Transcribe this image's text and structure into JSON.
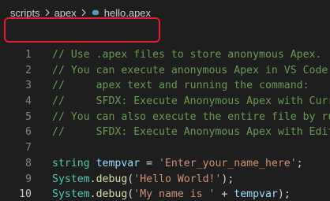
{
  "breadcrumb": {
    "items": [
      "scripts",
      "apex",
      "hello.apex"
    ]
  },
  "lines": [
    {
      "n": "1",
      "text": "// Use .apex files to store anonymous Apex."
    },
    {
      "n": "2",
      "text": "// You can execute anonymous Apex in VS Code by selecting the"
    },
    {
      "n": "3",
      "text": "//     apex text and running the command:"
    },
    {
      "n": "4",
      "text": "//     SFDX: Execute Anonymous Apex with Currently Selected Text"
    },
    {
      "n": "5",
      "text": "// You can also execute the entire file by running the command:"
    },
    {
      "n": "6",
      "text": "//     SFDX: Execute Anonymous Apex with Editor Contents"
    },
    {
      "n": "7",
      "text": ""
    },
    {
      "n": "8",
      "tokens": [
        "string",
        "tempvar",
        " = ",
        "'Enter_your_name_here'",
        ";"
      ]
    },
    {
      "n": "9",
      "tokens": [
        "System",
        ".",
        "debug",
        "(",
        "'Hello World!'",
        ");"
      ]
    },
    {
      "n": "10",
      "tokens": [
        "System",
        ".",
        "debug",
        "(",
        "'My name is '",
        " + ",
        "tempvar",
        ");"
      ]
    }
  ],
  "colors": {
    "background": "#1e1e1e",
    "comment": "#6a9955",
    "string": "#ce9178",
    "type": "#4ec9b0",
    "variable": "#9cdcfe",
    "function": "#dcdcaa",
    "highlight_box": "#e0202e"
  },
  "icons": {
    "file_icon": "apex-file-icon",
    "separator": "chevron-right-icon"
  }
}
